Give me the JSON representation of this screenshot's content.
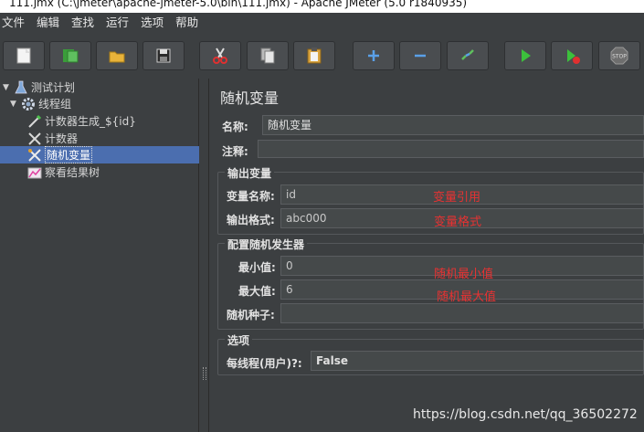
{
  "window": {
    "title": "111.jmx (C:\\jmeter\\apache-jmeter-5.0\\bin\\111.jmx) - Apache JMeter (5.0 r1840935)"
  },
  "menu": [
    "文件",
    "编辑",
    "查找",
    "运行",
    "选项",
    "帮助"
  ],
  "toolbar": {
    "buttons": [
      {
        "name": "new-icon"
      },
      {
        "name": "templates-icon"
      },
      {
        "name": "open-icon"
      },
      {
        "name": "save-icon"
      },
      {
        "name": "cut-icon"
      },
      {
        "name": "copy-icon"
      },
      {
        "name": "paste-icon"
      },
      {
        "name": "expand-icon"
      },
      {
        "name": "collapse-icon"
      },
      {
        "name": "toggle-icon"
      },
      {
        "name": "start-icon"
      },
      {
        "name": "start-no-pause-icon"
      },
      {
        "name": "stop-icon"
      }
    ],
    "stop_text": "STOP"
  },
  "tree": {
    "items": [
      {
        "label": "测试计划",
        "icon": "flask-icon"
      },
      {
        "label": "线程组",
        "icon": "gear-icon"
      },
      {
        "label": "计数器生成_${id}",
        "icon": "sampler-icon"
      },
      {
        "label": "计数器",
        "icon": "tools-icon"
      },
      {
        "label": "随机变量",
        "icon": "tools-icon",
        "selected": true
      },
      {
        "label": "察看结果树",
        "icon": "chart-icon"
      }
    ]
  },
  "panel": {
    "title": "随机变量",
    "name_label": "名称:",
    "name_value": "随机变量",
    "comment_label": "注释:",
    "comment_value": "",
    "output_group": {
      "title": "输出变量",
      "var_name_label": "变量名称:",
      "var_name_value": "id",
      "format_label": "输出格式:",
      "format_value": "abc000"
    },
    "random_group": {
      "title": "配置随机发生器",
      "min_label": "最小值:",
      "min_value": "0",
      "max_label": "最大值:",
      "max_value": "6",
      "seed_label": "随机种子:",
      "seed_value": ""
    },
    "options_group": {
      "title": "选项",
      "per_thread_label": "每线程(用户)?:",
      "per_thread_value": "False"
    },
    "annotations": {
      "var_ref": "变量引用",
      "var_format": "变量格式",
      "rand_min": "随机最小值",
      "rand_max": "随机最大值"
    }
  },
  "watermark": "https://blog.csdn.net/qq_36502272",
  "colors": {
    "selection": "#4b6eaf",
    "annotation": "#e83232",
    "background": "#3c3f41"
  }
}
